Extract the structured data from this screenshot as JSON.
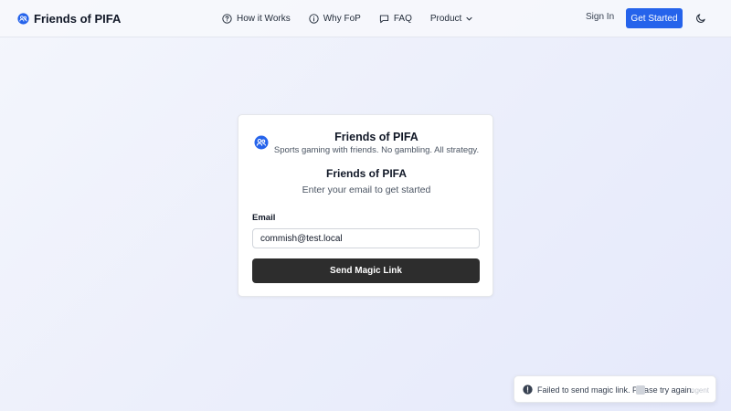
{
  "header": {
    "brand": "Friends of PIFA",
    "nav": [
      {
        "label": "How it Works",
        "icon": "help-circle-icon"
      },
      {
        "label": "Why FoP",
        "icon": "info-icon"
      },
      {
        "label": "FAQ",
        "icon": "message-square-icon"
      },
      {
        "label": "Product",
        "icon": "chevron-down-icon"
      }
    ],
    "sign_in": "Sign In",
    "get_started": "Get Started",
    "theme_icon": "moon-icon"
  },
  "card": {
    "brand_title": "Friends of PIFA",
    "brand_tagline": "Sports gaming with friends. No gambling. All strategy.",
    "title": "Friends of PIFA",
    "subtitle": "Enter your email to get started",
    "email_label": "Email",
    "email_value": "commish@test.local",
    "submit_label": "Send Magic Link"
  },
  "toast": {
    "message": "Failed to send magic link. Please try again.",
    "ghost_text": "ngent",
    "icon": "alert-circle-icon"
  },
  "colors": {
    "accent": "#2563eb",
    "submit_button": "#2d2d2d",
    "background": "#eceffb"
  }
}
